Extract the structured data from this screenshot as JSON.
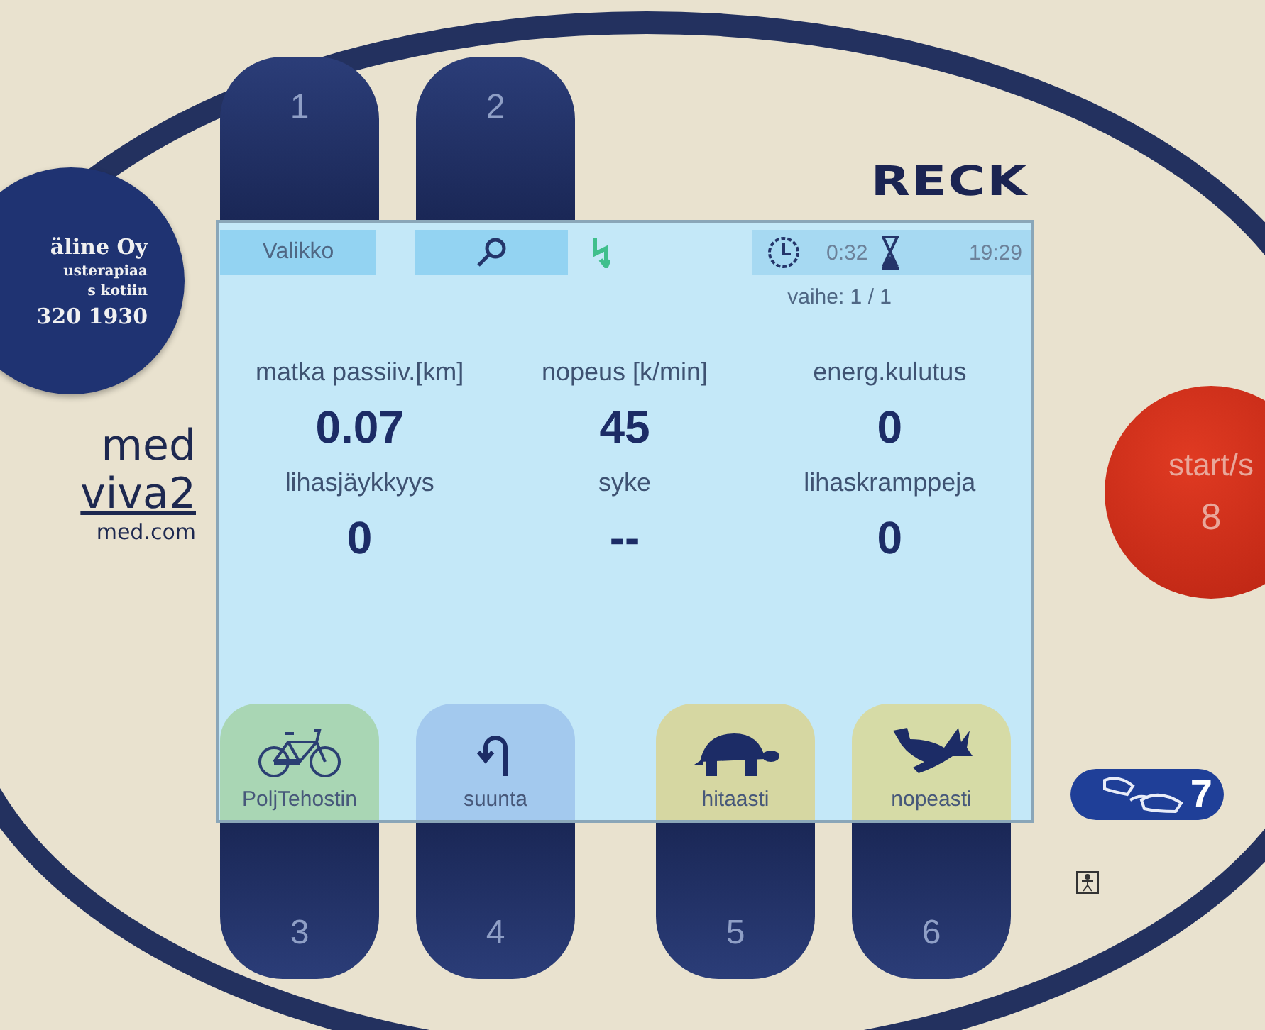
{
  "sticker": {
    "lines": [
      "äline Oy",
      "usterapiaa",
      "s kotiin",
      "320 1930"
    ]
  },
  "logo": {
    "lines": [
      "med",
      "viva2",
      "med.com"
    ]
  },
  "brand": "RECK",
  "top_keys": [
    "1",
    "2"
  ],
  "screen": {
    "menu_label": "Valikko",
    "elapsed": "0:32",
    "clock": "19:29",
    "phase": "vaihe: 1 / 1",
    "metrics": [
      {
        "label": "matka passiiv.[km]",
        "value": "0.07"
      },
      {
        "label": "nopeus [k/min]",
        "value": "45"
      },
      {
        "label": "energ.kulutus",
        "value": "0"
      },
      {
        "label": "lihasjäykkyys",
        "value": "0"
      },
      {
        "label": "syke",
        "value": "--"
      },
      {
        "label": "lihaskramppeja",
        "value": "0"
      }
    ],
    "soft_buttons": [
      {
        "label": "PoljTehostin",
        "color": "#a9d6b4"
      },
      {
        "label": "suunta",
        "color": "#a3c9ee"
      },
      {
        "label": "hitaasti",
        "color": "#d6d7a2"
      },
      {
        "label": "nopeasti",
        "color": "#d6dba6"
      }
    ]
  },
  "bottom_keys": [
    "3",
    "4",
    "5",
    "6"
  ],
  "start_key": {
    "label": "start/s",
    "number": "8"
  },
  "pedal_key": {
    "number": "7"
  }
}
